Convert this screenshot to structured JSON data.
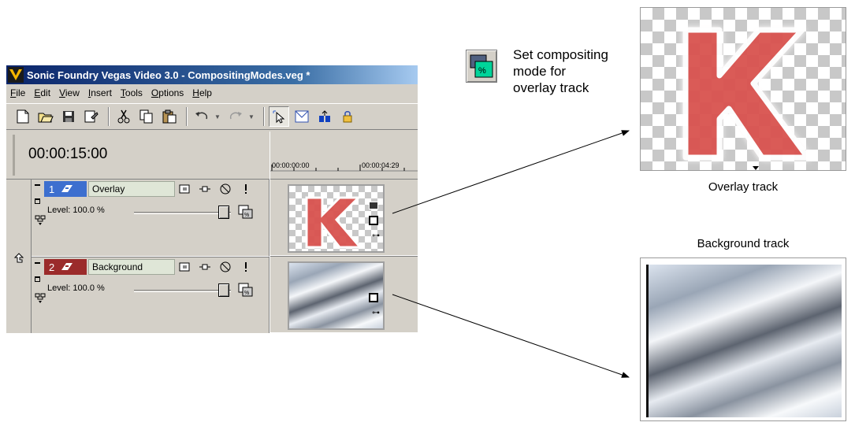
{
  "window": {
    "title": "Sonic Foundry Vegas Video 3.0 - CompositingModes.veg *"
  },
  "menu": [
    {
      "u": "F",
      "rest": "ile"
    },
    {
      "u": "E",
      "rest": "dit"
    },
    {
      "u": "V",
      "rest": "iew"
    },
    {
      "u": "I",
      "rest": "nsert"
    },
    {
      "u": "T",
      "rest": "ools"
    },
    {
      "u": "O",
      "rest": "ptions"
    },
    {
      "u": "H",
      "rest": "elp"
    }
  ],
  "toolbar_icons": [
    "new-icon",
    "open-icon",
    "save-icon",
    "properties-icon",
    "cut-icon",
    "copy-icon",
    "paste-icon",
    "undo-icon",
    "redo-icon",
    "normal-edit-tool-icon",
    "envelope-tool-icon",
    "selection-tool-icon",
    "lock-icon"
  ],
  "timecode": "00:00:15:00",
  "ruler": {
    "start": "00:00:00:00",
    "end": "00:00:04:29"
  },
  "tracks": [
    {
      "number": "1",
      "name": "Overlay",
      "level_label": "Level: 100.0 %",
      "level": 100.0,
      "color": "#3d6fcf"
    },
    {
      "number": "2",
      "name": "Background",
      "level_label": "Level: 100.0 %",
      "level": 100.0,
      "color": "#9b2b2b"
    }
  ],
  "overlay_letter": "K",
  "callout": {
    "line1": "Set compositing",
    "line2": "mode for",
    "line3": "overlay track"
  },
  "previews": {
    "overlay_caption": "Overlay track",
    "background_caption": "Background track"
  },
  "colors": {
    "title_bar": "#0a246a",
    "k_red": "#d9534f",
    "compositing_icon": "#00d49a"
  }
}
